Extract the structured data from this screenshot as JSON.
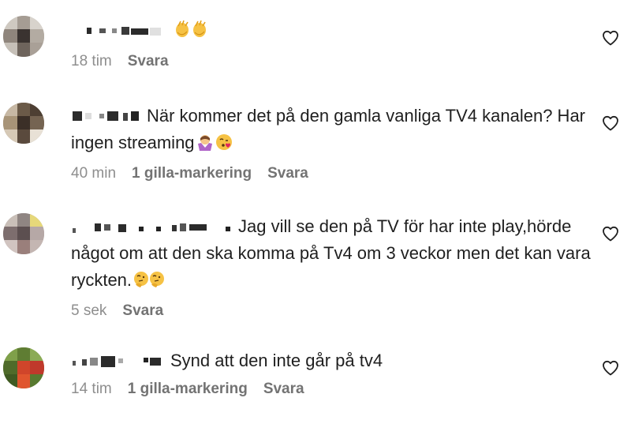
{
  "comments": [
    {
      "text": "",
      "emojis": [
        "clapping-hands",
        "clapping-hands"
      ],
      "time": "18 tim",
      "likes": "",
      "reply": "Svara",
      "like_icon": "heart-outline"
    },
    {
      "text": "När kommer det på den gamla vanliga TV4 kanalen? Har ingen streaming",
      "emojis": [
        "woman-shrugging",
        "face-blowing-kiss"
      ],
      "time": "40 min",
      "likes": "1 gilla-markering",
      "reply": "Svara",
      "like_icon": "heart-outline"
    },
    {
      "text": "Jag vill se den på TV för har inte play,hörde något om att den ska komma på Tv4 om 3 veckor men det kan vara ryckten.",
      "emojis": [
        "thinking-face",
        "thinking-face"
      ],
      "time": "5 sek",
      "likes": "",
      "reply": "Svara",
      "like_icon": "heart-outline"
    },
    {
      "text": "Synd att den inte går på tv4",
      "emojis": [],
      "time": "14 tim",
      "likes": "1 gilla-markering",
      "reply": "Svara",
      "like_icon": "heart-outline"
    }
  ],
  "colors": {
    "text": "#1f1f1f",
    "meta": "#737373",
    "redaction": "#2b2b2b"
  }
}
